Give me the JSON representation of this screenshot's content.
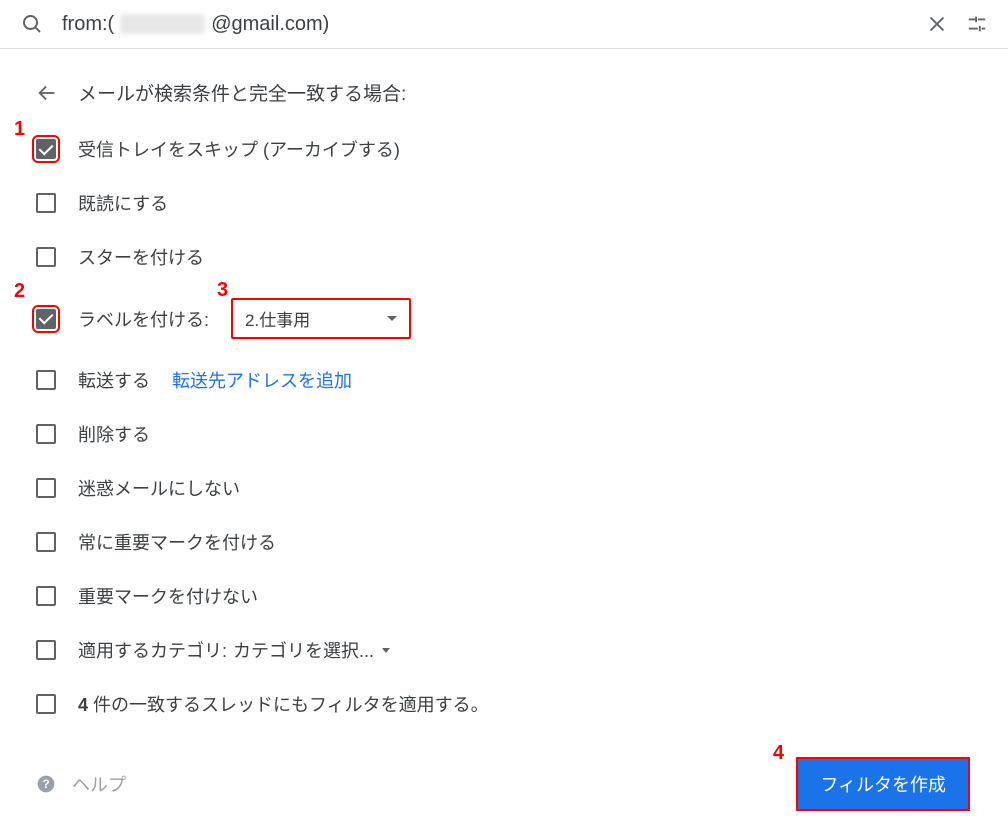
{
  "search": {
    "query_prefix": "from:(",
    "query_suffix": "@gmail.com)"
  },
  "heading": "メールが検索条件と完全一致する場合:",
  "options": {
    "skip_inbox": "受信トレイをスキップ (アーカイブする)",
    "mark_read": "既読にする",
    "star": "スターを付ける",
    "apply_label": "ラベルを付ける:",
    "label_dropdown_value": "2.仕事用",
    "forward": "転送する",
    "forward_link": "転送先アドレスを追加",
    "delete": "削除する",
    "never_spam": "迷惑メールにしない",
    "always_important": "常に重要マークを付ける",
    "never_important": "重要マークを付けない",
    "category": "適用するカテゴリ:",
    "category_dropdown_value": "カテゴリを選択...",
    "apply_existing_prefix": "4",
    "apply_existing_suffix": "件の一致するスレッドにもフィルタを適用する。"
  },
  "footer": {
    "help": "ヘルプ",
    "create_button": "フィルタを作成"
  },
  "annotations": {
    "a1": "1",
    "a2": "2",
    "a3": "3",
    "a4": "4"
  }
}
